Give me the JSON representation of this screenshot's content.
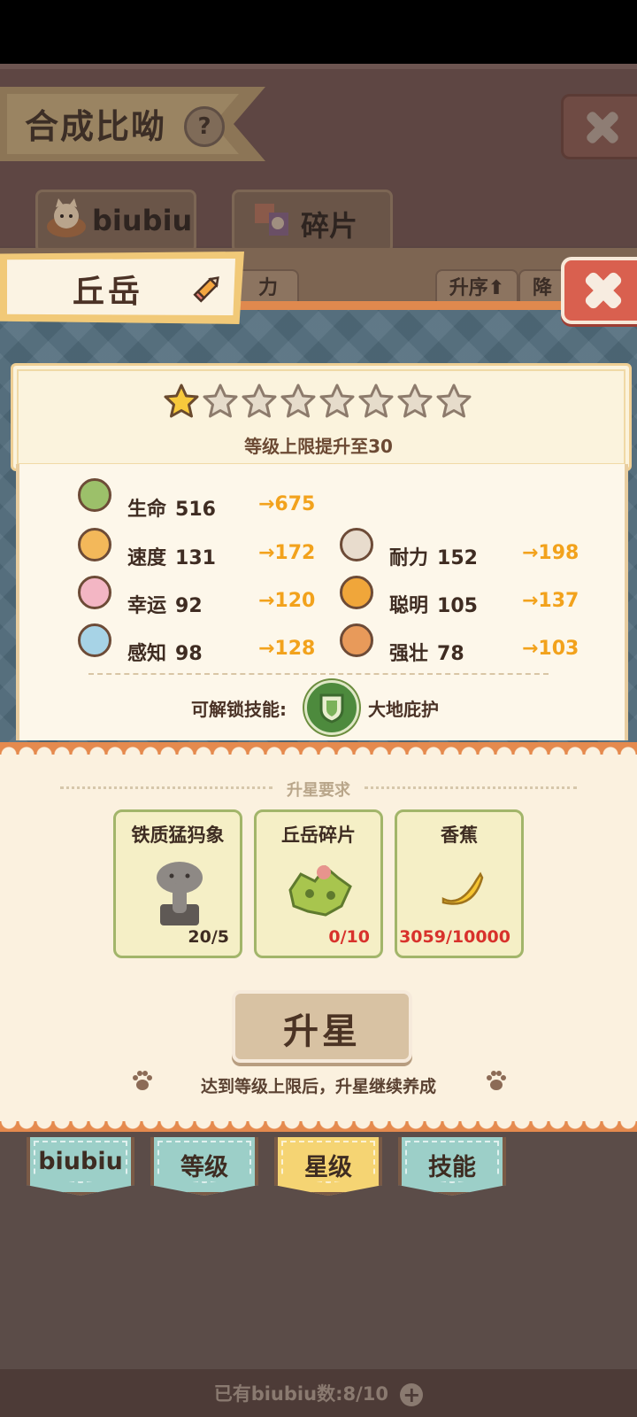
{
  "background": {
    "title": "合成比呦",
    "help_glyph": "?",
    "tabs": [
      {
        "label": "biubiu"
      },
      {
        "label": "碎片"
      }
    ],
    "sort_partial": "力",
    "sort_asc": "升序",
    "sort_desc_partial": "降"
  },
  "pet": {
    "name": "丘岳",
    "stars_total": 8,
    "stars_filled": 1,
    "level_cap_text": "等级上限提升至30"
  },
  "stats": {
    "hp": {
      "label": "生命",
      "value": "516",
      "next": "→675"
    },
    "speed": {
      "label": "速度",
      "value": "131",
      "next": "→172"
    },
    "endurance": {
      "label": "耐力",
      "value": "152",
      "next": "→198"
    },
    "luck": {
      "label": "幸运",
      "value": "92",
      "next": "→120"
    },
    "smart": {
      "label": "聪明",
      "value": "105",
      "next": "→137"
    },
    "perception": {
      "label": "感知",
      "value": "98",
      "next": "→128"
    },
    "strong": {
      "label": "强壮",
      "value": "78",
      "next": "→103"
    }
  },
  "skill": {
    "unlock_label": "可解锁技能:",
    "name": "大地庇护"
  },
  "requirements": {
    "title": "升星要求",
    "items": [
      {
        "name": "铁质猛犸象",
        "count": "20/5",
        "count_color": "#3e2c22"
      },
      {
        "name": "丘岳碎片",
        "count": "0/10",
        "count_color": "#d8322c"
      },
      {
        "name": "香蕉",
        "count": "3059/10000",
        "count_color": "#d8322c"
      }
    ]
  },
  "upgrade_button": "升星",
  "hint": "达到等级上限后，升星继续养成",
  "bottom_tabs": [
    {
      "label": "biubiu",
      "color": "#9ccfc8",
      "active": false
    },
    {
      "label": "等级",
      "color": "#9ccfc8",
      "active": false
    },
    {
      "label": "星级",
      "color": "#f5d473",
      "active": true
    },
    {
      "label": "技能",
      "color": "#9ccfc8",
      "active": false
    }
  ],
  "footer": {
    "count_text": "已有biubiu数:8/10"
  }
}
